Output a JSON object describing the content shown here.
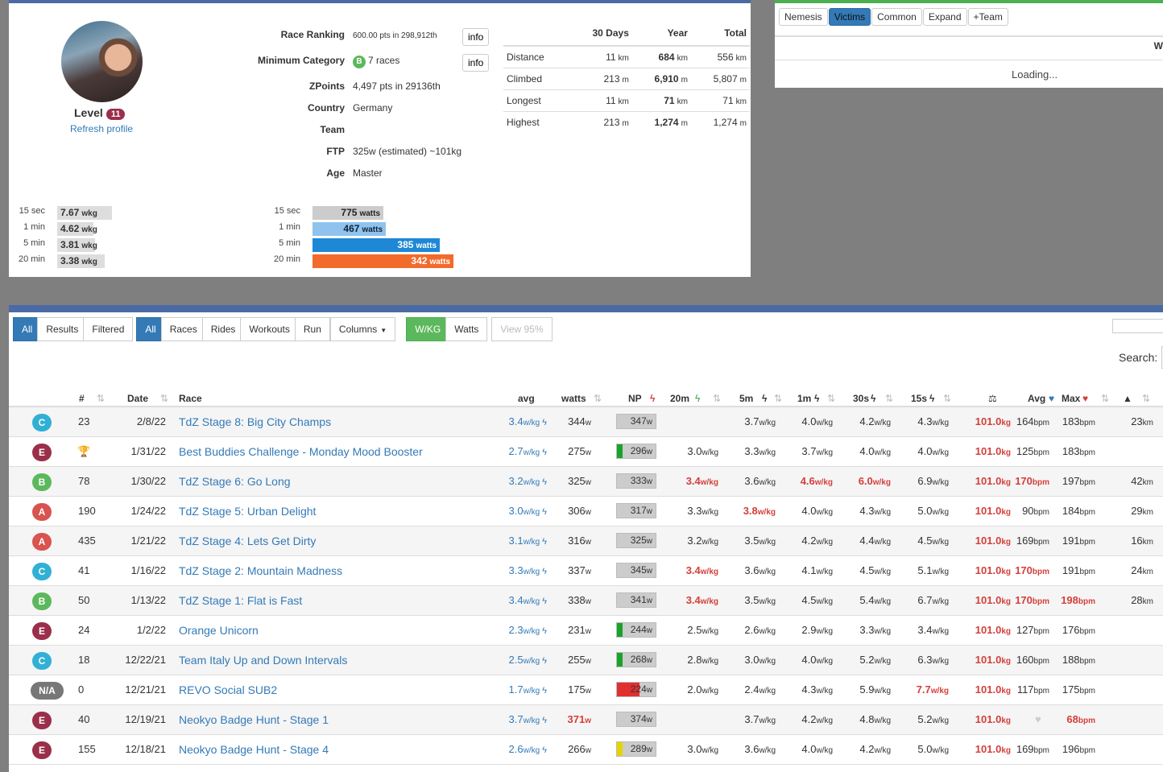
{
  "profile": {
    "level_label": "Level",
    "level": "11",
    "refresh": "Refresh profile",
    "fields": [
      {
        "label": "Race Ranking",
        "value": "600.00 pts in 298,912th"
      },
      {
        "label": "Minimum Category",
        "value": "7 races",
        "badge": "B"
      },
      {
        "label": "ZPoints",
        "value": "4,497 pts in 29136th"
      },
      {
        "label": "Country",
        "value": "Germany"
      },
      {
        "label": "Team",
        "value": ""
      },
      {
        "label": "FTP",
        "value": "325w (estimated) ~101kg"
      },
      {
        "label": "Age",
        "value": "Master"
      }
    ],
    "info_button": "info",
    "stats": {
      "headers": [
        "",
        "30 Days",
        "Year",
        "Total"
      ],
      "rows": [
        {
          "label": "Distance",
          "d30": "11",
          "y": "684",
          "t": "556",
          "unit": "km"
        },
        {
          "label": "Climbed",
          "d30": "213",
          "y": "6,910",
          "t": "5,807",
          "unit": "m"
        },
        {
          "label": "Longest",
          "d30": "11",
          "y": "71",
          "t": "71",
          "unit": "km"
        },
        {
          "label": "Highest",
          "d30": "213",
          "y": "1,274",
          "t": "1,274",
          "unit": "m"
        }
      ]
    },
    "wkg_bars": [
      {
        "label": "15 sec",
        "value": "7.67",
        "unit": "wkg",
        "fraction": 0.38
      },
      {
        "label": "1 min",
        "value": "4.62",
        "unit": "wkg",
        "fraction": 0.25
      },
      {
        "label": "5 min",
        "value": "3.81",
        "unit": "wkg",
        "fraction": 0.26
      },
      {
        "label": "20 min",
        "value": "3.38",
        "unit": "wkg",
        "fraction": 0.33
      }
    ],
    "watt_bars": [
      {
        "label": "15 sec",
        "value": "775",
        "unit": "watts",
        "fraction": 0.5,
        "color": "#ccc"
      },
      {
        "label": "1 min",
        "value": "467",
        "unit": "watts",
        "fraction": 0.52,
        "color": "#8fc3ee"
      },
      {
        "label": "5 min",
        "value": "385",
        "unit": "watts",
        "fraction": 0.9,
        "color": "#1e88d6"
      },
      {
        "label": "20 min",
        "value": "342",
        "unit": "watts",
        "fraction": 1.0,
        "color": "#f36b2b"
      }
    ]
  },
  "victims_panel": {
    "buttons": [
      "Nemesis",
      "Victims",
      "Common",
      "Expand",
      "+Team"
    ],
    "active": "Victims",
    "loading": "Loading...",
    "cut_text": "W"
  },
  "toolbar": {
    "group1": [
      "All",
      "Results",
      "Filtered"
    ],
    "group2": [
      "All",
      "Races",
      "Rides",
      "Workouts",
      "Run"
    ],
    "columns": "Columns",
    "group3": [
      "W/KG",
      "Watts"
    ],
    "view95": "View 95%",
    "search_label": "Search:"
  },
  "table_headers": {
    "rank": "#",
    "date": "Date",
    "race": "Race",
    "avg": "avg",
    "watts": "watts",
    "np": "NP",
    "m20": "20m",
    "m5": "5m",
    "m1": "1m",
    "s30": "30s",
    "s15": "15s",
    "avg_hr": "Avg",
    "max_hr": "Max"
  },
  "colors": {
    "A": "#d9534f",
    "B": "#5cb85c",
    "C": "#31b0d5",
    "E": "#9b2f4a",
    "N/A": "#777"
  },
  "rows": [
    {
      "cat": "C",
      "rank": "23",
      "date": "2/8/22",
      "race": "TdZ Stage 8: Big City Champs",
      "avg": "3.4",
      "watts": "344",
      "np": "347",
      "np_color": "",
      "m20": "",
      "m5": "3.7",
      "m1": "4.0",
      "s30": "4.2",
      "s15": "4.3",
      "kg": "101.0",
      "hr": "164",
      "max": "183",
      "km": "23"
    },
    {
      "cat": "E",
      "rank": "",
      "trophy": true,
      "date": "1/31/22",
      "race": "Best Buddies Challenge - Monday Mood Booster",
      "avg": "2.7",
      "watts": "275",
      "np": "296",
      "np_color": "#1aa32a",
      "m20": "3.0",
      "m5": "3.3",
      "m1": "3.7",
      "s30": "4.0",
      "s15": "4.0",
      "kg": "101.0",
      "hr": "125",
      "max": "183",
      "km": ""
    },
    {
      "cat": "B",
      "rank": "78",
      "date": "1/30/22",
      "race": "TdZ Stage 6: Go Long",
      "avg": "3.2",
      "watts": "325",
      "np": "333",
      "np_color": "",
      "m20": "3.4",
      "m20_red": true,
      "m5": "3.6",
      "m1": "4.6",
      "m1_red": true,
      "s30": "6.0",
      "s30_red": true,
      "s15": "6.9",
      "kg": "101.0",
      "hr": "170",
      "hr_red": true,
      "max": "197",
      "km": "42"
    },
    {
      "cat": "A",
      "rank": "190",
      "date": "1/24/22",
      "race": "TdZ Stage 5: Urban Delight",
      "avg": "3.0",
      "watts": "306",
      "np": "317",
      "np_color": "",
      "m20": "3.3",
      "m5": "3.8",
      "m5_red": true,
      "m1": "4.0",
      "s30": "4.3",
      "s15": "5.0",
      "kg": "101.0",
      "hr": "90",
      "max": "184",
      "km": "29"
    },
    {
      "cat": "A",
      "rank": "435",
      "date": "1/21/22",
      "race": "TdZ Stage 4: Lets Get Dirty",
      "avg": "3.1",
      "watts": "316",
      "np": "325",
      "np_color": "",
      "m20": "3.2",
      "m5": "3.5",
      "m1": "4.2",
      "s30": "4.4",
      "s15": "4.5",
      "kg": "101.0",
      "hr": "169",
      "max": "191",
      "km": "16"
    },
    {
      "cat": "C",
      "rank": "41",
      "date": "1/16/22",
      "race": "TdZ Stage 2: Mountain Madness",
      "avg": "3.3",
      "watts": "337",
      "np": "345",
      "np_color": "",
      "m20": "3.4",
      "m20_red": true,
      "m5": "3.6",
      "m1": "4.1",
      "s30": "4.5",
      "s15": "5.1",
      "kg": "101.0",
      "hr": "170",
      "hr_red": true,
      "max": "191",
      "km": "24"
    },
    {
      "cat": "B",
      "rank": "50",
      "date": "1/13/22",
      "race": "TdZ Stage 1: Flat is Fast",
      "avg": "3.4",
      "watts": "338",
      "np": "341",
      "np_color": "",
      "m20": "3.4",
      "m20_red": true,
      "m5": "3.5",
      "m1": "4.5",
      "s30": "5.4",
      "s15": "6.7",
      "kg": "101.0",
      "hr": "170",
      "hr_red": true,
      "max": "198",
      "max_red": true,
      "km": "28"
    },
    {
      "cat": "E",
      "rank": "24",
      "date": "1/2/22",
      "race": "Orange Unicorn",
      "avg": "2.3",
      "watts": "231",
      "np": "244",
      "np_color": "#1aa32a",
      "m20": "2.5",
      "m5": "2.6",
      "m1": "2.9",
      "s30": "3.3",
      "s15": "3.4",
      "kg": "101.0",
      "hr": "127",
      "max": "176",
      "km": ""
    },
    {
      "cat": "C",
      "rank": "18",
      "date": "12/22/21",
      "race": "Team Italy Up and Down Intervals",
      "avg": "2.5",
      "watts": "255",
      "np": "268",
      "np_color": "#1aa32a",
      "m20": "2.8",
      "m5": "3.0",
      "m1": "4.0",
      "s30": "5.2",
      "s15": "6.3",
      "kg": "101.0",
      "hr": "160",
      "max": "188",
      "km": ""
    },
    {
      "cat": "N/A",
      "rank": "0",
      "date": "12/21/21",
      "race": "REVO Social SUB2",
      "avg": "1.7",
      "watts": "175",
      "np": "224",
      "np_color": "#e03030",
      "np_full": true,
      "m20": "2.0",
      "m5": "2.4",
      "m1": "4.3",
      "s30": "5.9",
      "s15": "7.7",
      "s15_red": true,
      "kg": "101.0",
      "hr": "117",
      "max": "175",
      "km": ""
    },
    {
      "cat": "E",
      "rank": "40",
      "date": "12/19/21",
      "race": "Neokyo Badge Hunt - Stage 1",
      "avg": "3.7",
      "avg_blue": true,
      "watts": "371",
      "watts_red": true,
      "np": "374",
      "np_color": "",
      "m20": "",
      "m5": "3.7",
      "m1": "4.2",
      "s30": "4.8",
      "s15": "5.2",
      "kg": "101.0",
      "hr": "",
      "max": "68",
      "max_red": true,
      "km": ""
    },
    {
      "cat": "E",
      "rank": "155",
      "date": "12/18/21",
      "race": "Neokyo Badge Hunt - Stage 4",
      "avg": "2.6",
      "watts": "266",
      "np": "289",
      "np_color": "#e6d400",
      "m20": "3.0",
      "m5": "3.6",
      "m1": "4.0",
      "s30": "4.2",
      "s15": "5.0",
      "kg": "101.0",
      "hr": "169",
      "max": "196",
      "km": ""
    }
  ]
}
